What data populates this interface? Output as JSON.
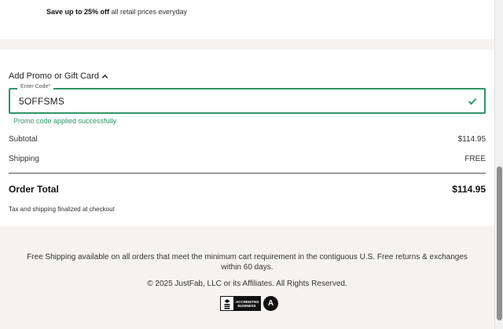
{
  "promo_banner": {
    "bold_text": "Save up to 25% off",
    "rest_text": " all retail prices everyday"
  },
  "promo": {
    "toggle_label": "Add Promo or Gift Card",
    "field_label": "Enter Code*",
    "code_value": "5OFFSMS",
    "status_message": "Promo code applied successfully"
  },
  "summary": {
    "subtotal_label": "Subtotal",
    "subtotal_value": "$114.95",
    "shipping_label": "Shipping",
    "shipping_value": "FREE",
    "total_label": "Order Total",
    "total_value": "$114.95",
    "tax_note": "Tax and shipping finalized at checkout"
  },
  "footer": {
    "shipping_note": "Free Shipping available on all orders that meet the minimum cart requirement in the contiguous U.S. Free returns & exchanges within 60 days.",
    "copyright": "© 2025 JustFab, LLC or its Affiliates. All Rights Reserved.",
    "bbb_line1": "ACCREDITED",
    "bbb_line2": "BUSINESS",
    "rating_grade": "A"
  },
  "colors": {
    "success": "#2f9469",
    "page_bg": "#f5f3ef"
  }
}
